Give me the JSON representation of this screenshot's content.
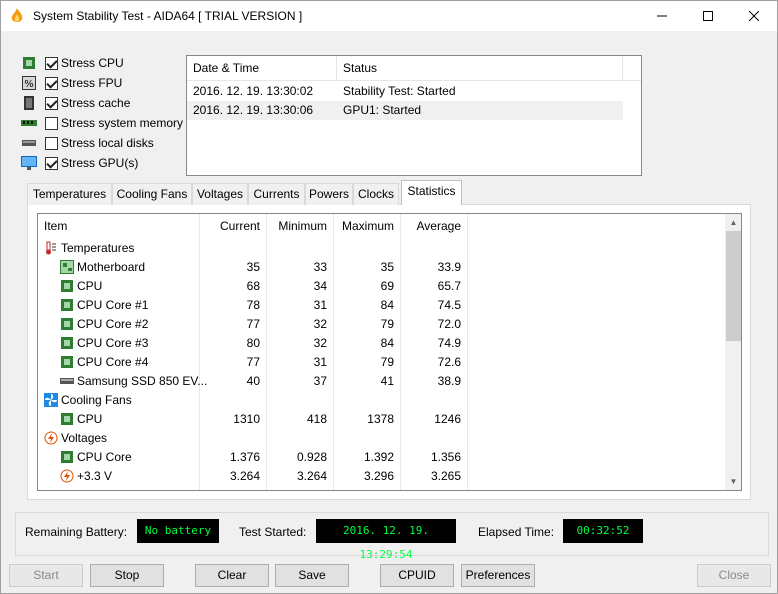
{
  "window": {
    "title": "System Stability Test - AIDA64  [ TRIAL VERSION ]"
  },
  "icons": {
    "app": "flame-icon",
    "minimize": "minimize-icon",
    "maximize": "maximize-icon",
    "close": "close-icon",
    "cpu": "cpu-chip-icon",
    "fpu": "fpu-percent-icon",
    "cache": "cache-icon",
    "memory": "memory-module-icon",
    "disk": "disk-drive-icon",
    "gpu": "monitor-gpu-icon",
    "temperature": "thermometer-icon",
    "fan": "fan-icon",
    "voltage": "voltage-bolt-icon",
    "motherboard": "motherboard-icon",
    "ssd": "ssd-drive-icon"
  },
  "colors": {
    "accent_lcd_text": "#00ff40",
    "lcd_bg": "#000000",
    "selected_row": "#f0f0f0"
  },
  "stress_options": [
    {
      "label": "Stress CPU",
      "checked": true
    },
    {
      "label": "Stress FPU",
      "checked": true
    },
    {
      "label": "Stress cache",
      "checked": true
    },
    {
      "label": "Stress system memory",
      "checked": false
    },
    {
      "label": "Stress local disks",
      "checked": false
    },
    {
      "label": "Stress GPU(s)",
      "checked": true
    }
  ],
  "log": {
    "headers": [
      "Date & Time",
      "Status"
    ],
    "rows": [
      {
        "time": "2016. 12. 19. 13:30:02",
        "status": "Stability Test: Started"
      },
      {
        "time": "2016. 12. 19. 13:30:06",
        "status": "GPU1: Started"
      }
    ]
  },
  "tabs": [
    "Temperatures",
    "Cooling Fans",
    "Voltages",
    "Currents",
    "Powers",
    "Clocks",
    "Statistics"
  ],
  "active_tab": "Statistics",
  "stats": {
    "headers": [
      "Item",
      "Current",
      "Minimum",
      "Maximum",
      "Average"
    ],
    "rows": [
      {
        "item": "Temperatures",
        "group": true,
        "current": "",
        "min": "",
        "max": "",
        "avg": ""
      },
      {
        "item": "Motherboard",
        "group": false,
        "current": "35",
        "min": "33",
        "max": "35",
        "avg": "33.9"
      },
      {
        "item": "CPU",
        "group": false,
        "current": "68",
        "min": "34",
        "max": "69",
        "avg": "65.7"
      },
      {
        "item": "CPU Core #1",
        "group": false,
        "current": "78",
        "min": "31",
        "max": "84",
        "avg": "74.5"
      },
      {
        "item": "CPU Core #2",
        "group": false,
        "current": "77",
        "min": "32",
        "max": "79",
        "avg": "72.0"
      },
      {
        "item": "CPU Core #3",
        "group": false,
        "current": "80",
        "min": "32",
        "max": "84",
        "avg": "74.9"
      },
      {
        "item": "CPU Core #4",
        "group": false,
        "current": "77",
        "min": "31",
        "max": "79",
        "avg": "72.6"
      },
      {
        "item": "Samsung SSD 850 EV...",
        "group": false,
        "current": "40",
        "min": "37",
        "max": "41",
        "avg": "38.9"
      },
      {
        "item": "Cooling Fans",
        "group": true,
        "current": "",
        "min": "",
        "max": "",
        "avg": ""
      },
      {
        "item": "CPU",
        "group": false,
        "current": "1310",
        "min": "418",
        "max": "1378",
        "avg": "1246"
      },
      {
        "item": "Voltages",
        "group": true,
        "current": "",
        "min": "",
        "max": "",
        "avg": ""
      },
      {
        "item": "CPU Core",
        "group": false,
        "current": "1.376",
        "min": "0.928",
        "max": "1.392",
        "avg": "1.356"
      },
      {
        "item": "+3.3 V",
        "group": false,
        "current": "3.264",
        "min": "3.264",
        "max": "3.296",
        "avg": "3.265"
      }
    ]
  },
  "status": {
    "battery_label": "Remaining Battery:",
    "battery_value": "No battery",
    "started_label": "Test Started:",
    "started_value": "2016. 12. 19. 13:29:54",
    "elapsed_label": "Elapsed Time:",
    "elapsed_value": "00:32:52"
  },
  "buttons": {
    "start": "Start",
    "stop": "Stop",
    "clear": "Clear",
    "save": "Save",
    "cpuid": "CPUID",
    "preferences": "Preferences",
    "close": "Close"
  }
}
